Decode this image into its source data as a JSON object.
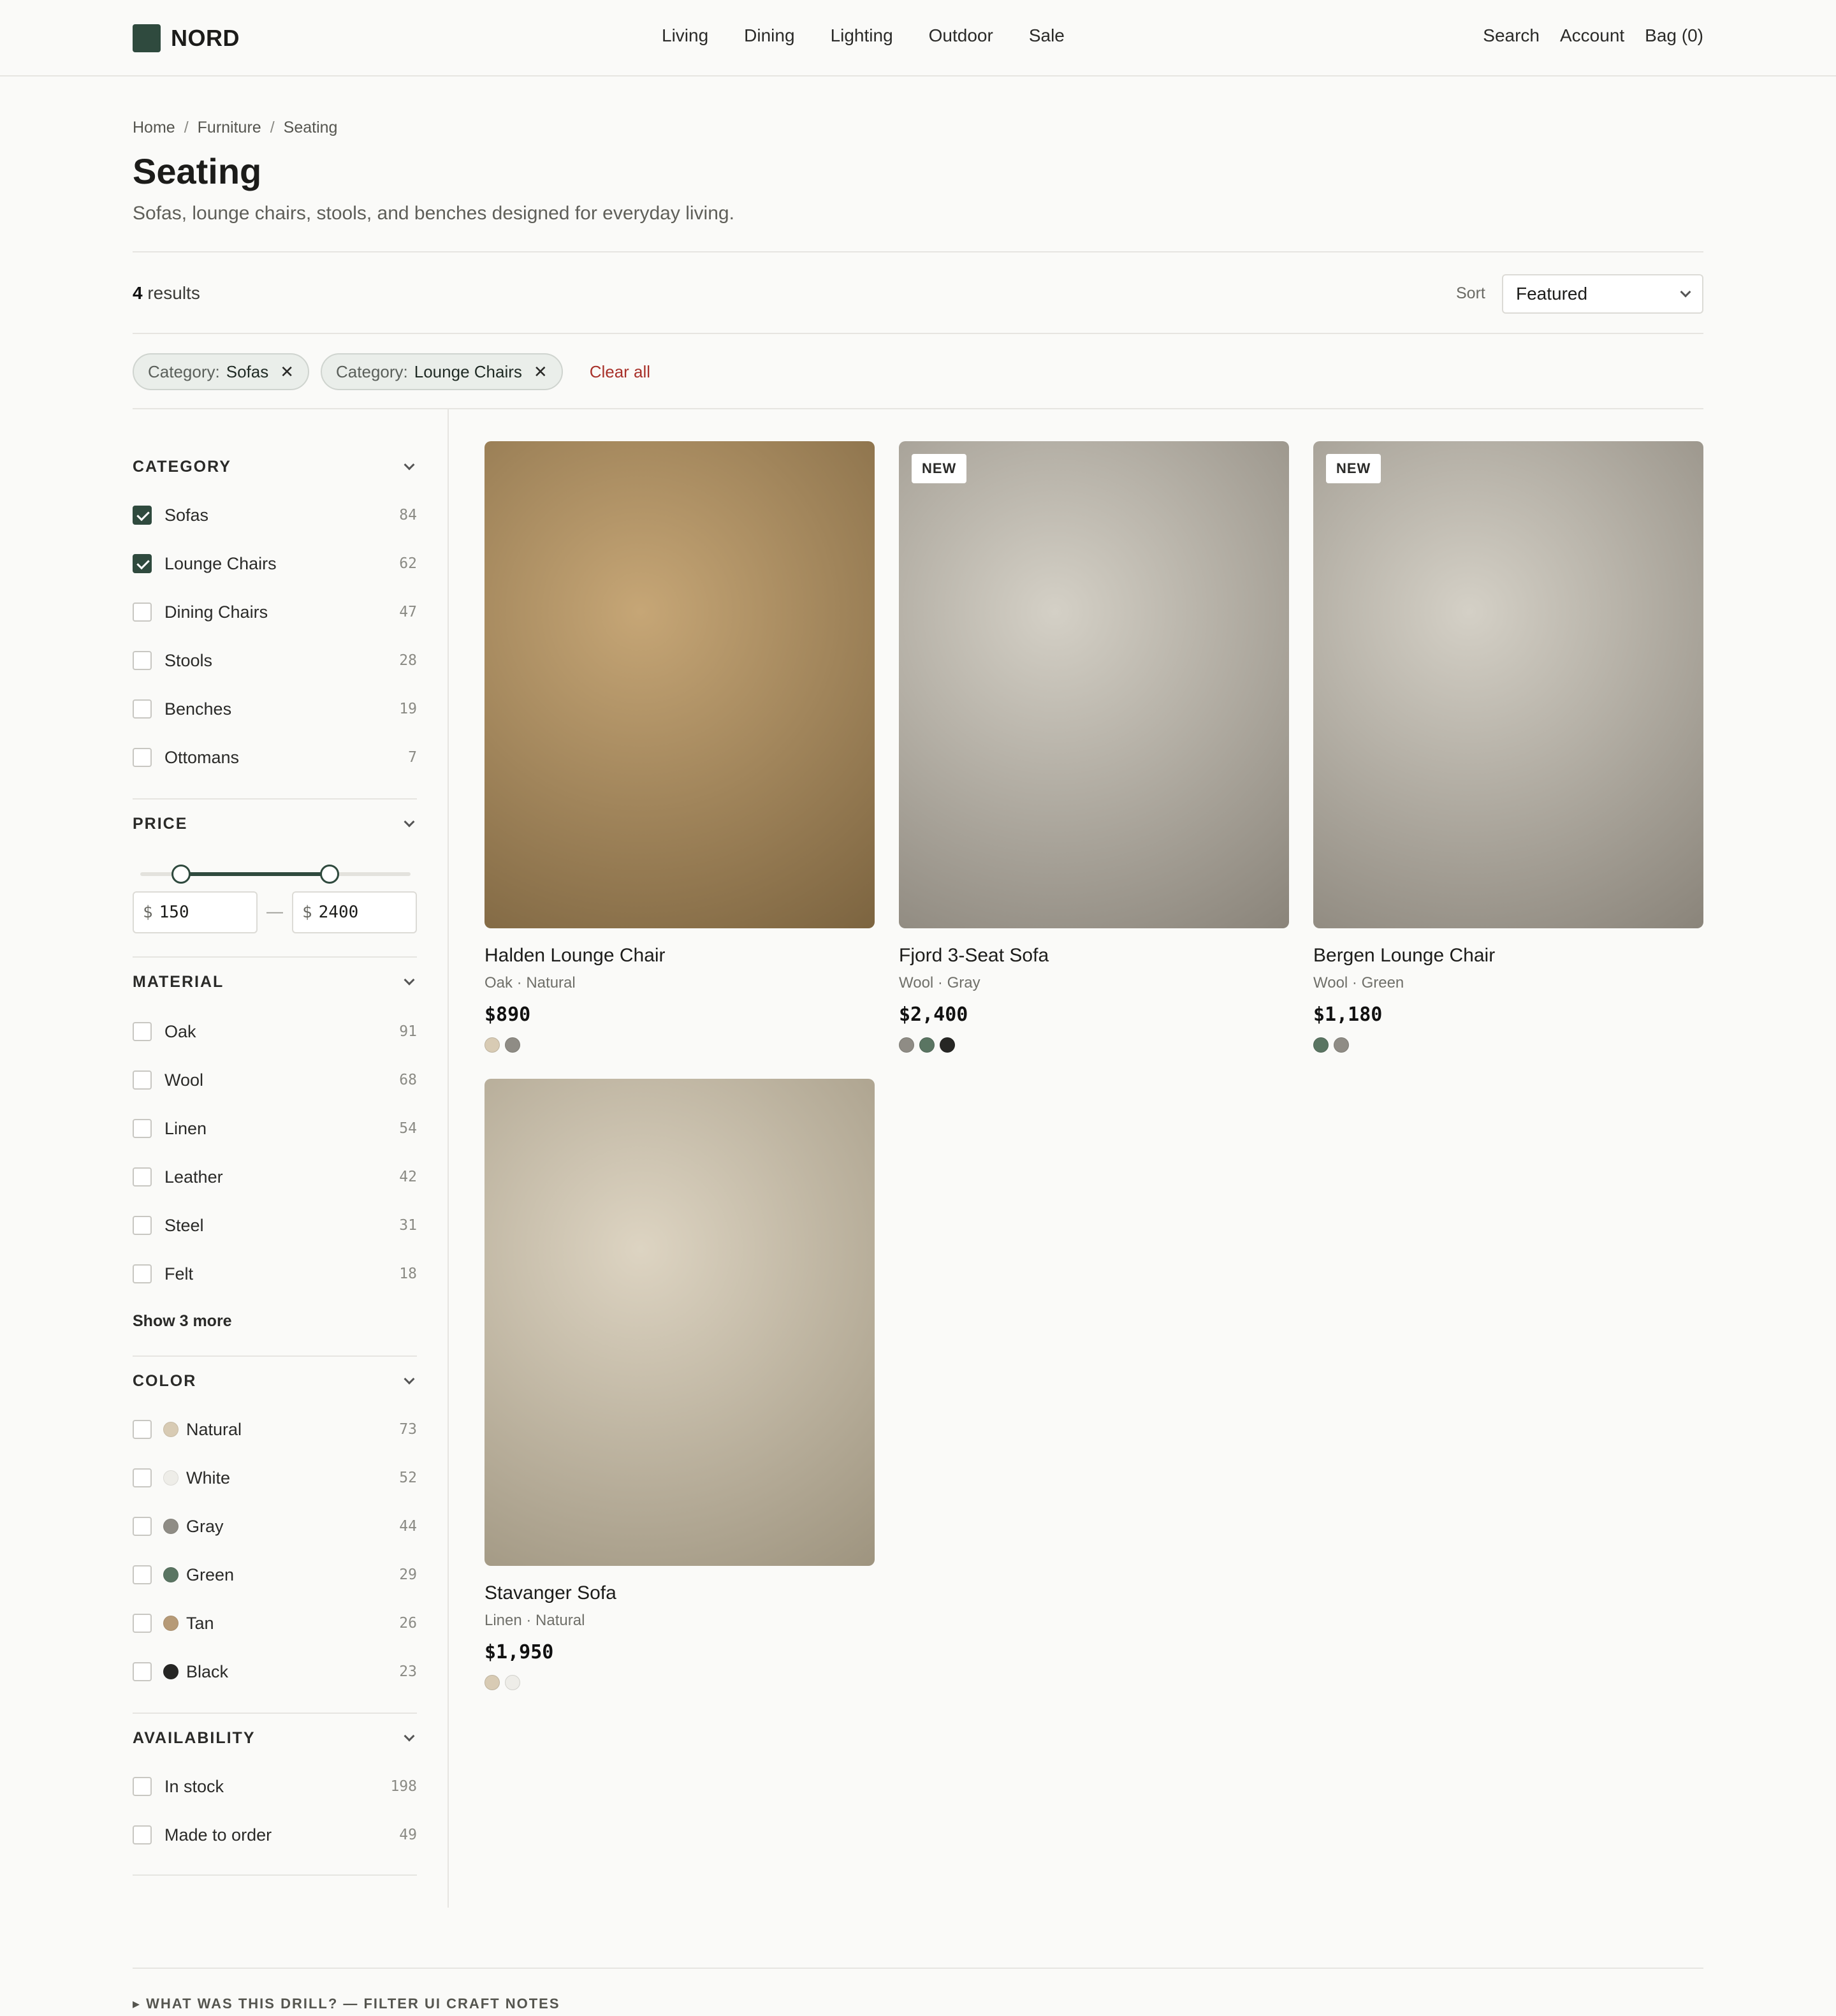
{
  "brand": {
    "name": "NORD",
    "accent": "#2f4a3e"
  },
  "nav": [
    "Living",
    "Dining",
    "Lighting",
    "Outdoor",
    "Sale"
  ],
  "utility": [
    "Search",
    "Account",
    "Bag (0)"
  ],
  "breadcrumb": [
    "Home",
    "Furniture",
    "Seating"
  ],
  "page": {
    "title": "Seating",
    "subtitle": "Sofas, lounge chairs, stools, and benches designed for everyday living."
  },
  "results": {
    "count": "4",
    "label": "results"
  },
  "sort": {
    "label": "Sort",
    "value": "Featured"
  },
  "chips": [
    {
      "key": "Category:",
      "value": "Sofas"
    },
    {
      "key": "Category:",
      "value": "Lounge Chairs"
    }
  ],
  "clear_all": "Clear all",
  "filters": {
    "category": {
      "title": "CATEGORY",
      "options": [
        {
          "label": "Sofas",
          "count": "84",
          "checked": true
        },
        {
          "label": "Lounge Chairs",
          "count": "62",
          "checked": true
        },
        {
          "label": "Dining Chairs",
          "count": "47",
          "checked": false
        },
        {
          "label": "Stools",
          "count": "28",
          "checked": false
        },
        {
          "label": "Benches",
          "count": "19",
          "checked": false
        },
        {
          "label": "Ottomans",
          "count": "7",
          "checked": false
        }
      ]
    },
    "price": {
      "title": "PRICE",
      "currency": "$",
      "min": "150",
      "max": "2400",
      "range_low_fraction": 0.15,
      "range_high_fraction": 0.7
    },
    "material": {
      "title": "MATERIAL",
      "options": [
        {
          "label": "Oak",
          "count": "91"
        },
        {
          "label": "Wool",
          "count": "68"
        },
        {
          "label": "Linen",
          "count": "54"
        },
        {
          "label": "Leather",
          "count": "42"
        },
        {
          "label": "Steel",
          "count": "31"
        },
        {
          "label": "Felt",
          "count": "18"
        }
      ],
      "show_more": "Show 3 more"
    },
    "color": {
      "title": "COLOR",
      "options": [
        {
          "label": "Natural",
          "count": "73",
          "swatch": "#d8cbb4"
        },
        {
          "label": "White",
          "count": "52",
          "swatch": "#eeede8"
        },
        {
          "label": "Gray",
          "count": "44",
          "swatch": "#8f8c85"
        },
        {
          "label": "Green",
          "count": "29",
          "swatch": "#5a7562"
        },
        {
          "label": "Tan",
          "count": "26",
          "swatch": "#b69a77"
        },
        {
          "label": "Black",
          "count": "23",
          "swatch": "#262624"
        }
      ]
    },
    "availability": {
      "title": "AVAILABILITY",
      "options": [
        {
          "label": "In stock",
          "count": "198"
        },
        {
          "label": "Made to order",
          "count": "49"
        }
      ]
    }
  },
  "products": [
    {
      "name": "Halden Lounge Chair",
      "meta": "Oak · Natural",
      "price": "$890",
      "badge": "",
      "gradient": [
        "#c6a676",
        "#7c6440"
      ],
      "swatches": [
        "#d8cbb4",
        "#8f8c85"
      ]
    },
    {
      "name": "Fjord 3-Seat Sofa",
      "meta": "Wool · Gray",
      "price": "$2,400",
      "badge": "NEW",
      "gradient": [
        "#d4d0c6",
        "#8a847a"
      ],
      "swatches": [
        "#8f8c85",
        "#5a7562",
        "#262624"
      ]
    },
    {
      "name": "Bergen Lounge Chair",
      "meta": "Wool · Green",
      "price": "$1,180",
      "badge": "NEW",
      "gradient": [
        "#d4d0c6",
        "#8a847a"
      ],
      "swatches": [
        "#5a7562",
        "#8f8c85"
      ]
    },
    {
      "name": "Stavanger Sofa",
      "meta": "Linen · Natural",
      "price": "$1,950",
      "badge": "",
      "gradient": [
        "#ddd4c2",
        "#9e947f"
      ],
      "swatches": [
        "#d8cbb4",
        "#eeede8"
      ]
    }
  ],
  "footer_note": "▸ WHAT WAS THIS DRILL? — FILTER UI CRAFT NOTES"
}
